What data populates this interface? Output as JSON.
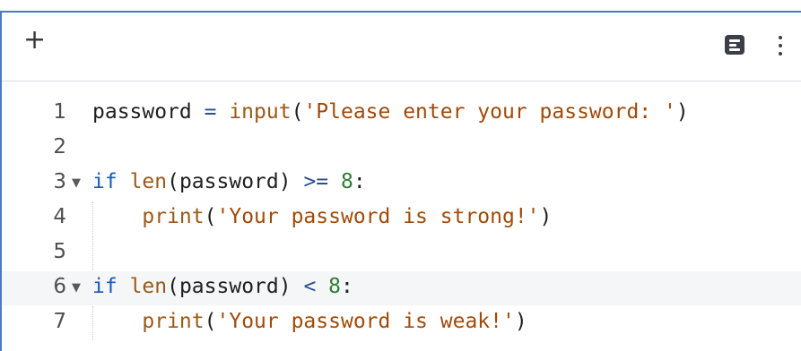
{
  "toolbar": {
    "add_label": "+",
    "add_icon": "plus-icon",
    "format_icon": "document-lines-icon",
    "more_icon": "vertical-dots-icon"
  },
  "editor": {
    "lines": [
      {
        "number": "1",
        "tokens": [
          {
            "t": "password",
            "c": "plain"
          },
          {
            "t": " = ",
            "c": "op"
          },
          {
            "t": "input",
            "c": "fn"
          },
          {
            "t": "(",
            "c": "plain"
          },
          {
            "t": "'Please enter your password: '",
            "c": "str"
          },
          {
            "t": ")",
            "c": "plain"
          }
        ]
      },
      {
        "number": "2",
        "tokens": []
      },
      {
        "number": "3",
        "fold": "▼",
        "tokens": [
          {
            "t": "if",
            "c": "kw"
          },
          {
            "t": " ",
            "c": "plain"
          },
          {
            "t": "len",
            "c": "fn"
          },
          {
            "t": "(password) ",
            "c": "plain"
          },
          {
            "t": ">=",
            "c": "op"
          },
          {
            "t": " ",
            "c": "plain"
          },
          {
            "t": "8",
            "c": "num"
          },
          {
            "t": ":",
            "c": "plain"
          }
        ]
      },
      {
        "number": "4",
        "indent": "    ",
        "tokens": [
          {
            "t": "print",
            "c": "fn"
          },
          {
            "t": "(",
            "c": "plain"
          },
          {
            "t": "'Your password is strong!'",
            "c": "str"
          },
          {
            "t": ")",
            "c": "plain"
          }
        ]
      },
      {
        "number": "5",
        "tokens": []
      },
      {
        "number": "6",
        "fold": "▼",
        "highlighted": true,
        "tokens": [
          {
            "t": "if",
            "c": "kw"
          },
          {
            "t": " ",
            "c": "plain"
          },
          {
            "t": "len",
            "c": "fn"
          },
          {
            "t": "(password) ",
            "c": "plain"
          },
          {
            "t": "<",
            "c": "op"
          },
          {
            "t": " ",
            "c": "plain"
          },
          {
            "t": "8",
            "c": "num"
          },
          {
            "t": ":",
            "c": "plain"
          }
        ]
      },
      {
        "number": "7",
        "indent": "    ",
        "tokens": [
          {
            "t": "print",
            "c": "fn"
          },
          {
            "t": "(",
            "c": "plain"
          },
          {
            "t": "'Your password is weak!'",
            "c": "str"
          },
          {
            "t": ")",
            "c": "plain"
          }
        ]
      }
    ]
  }
}
